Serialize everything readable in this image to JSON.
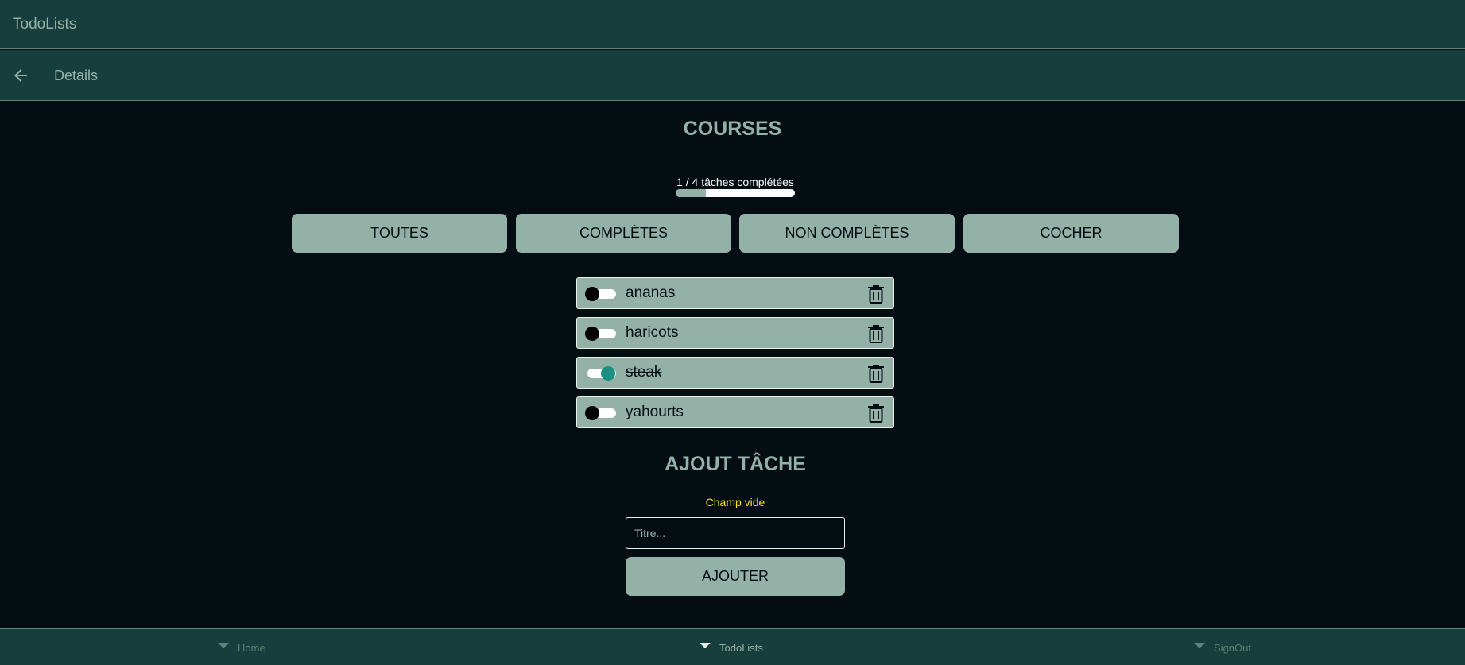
{
  "app": {
    "title": "TodoLists"
  },
  "subheader": {
    "title": "Details",
    "back_icon": "arrow-left-icon"
  },
  "list": {
    "title": "COURSES",
    "progress_text": "1 / 4 tâches complétées",
    "progress_fraction": 0.25
  },
  "filters": [
    {
      "label": "TOUTES"
    },
    {
      "label": "COMPLÈTES"
    },
    {
      "label": "NON COMPLÈTES"
    },
    {
      "label": "COCHER"
    }
  ],
  "todos": [
    {
      "label": "ananas",
      "done": false
    },
    {
      "label": "haricots",
      "done": false
    },
    {
      "label": "steak",
      "done": true
    },
    {
      "label": "yahourts",
      "done": false
    }
  ],
  "add_task": {
    "title": "AJOUT TÂCHE",
    "warning": "Champ vide",
    "input_placeholder": "Titre...",
    "input_value": "",
    "button_label": "AJOUTER"
  },
  "bottom_nav": [
    {
      "label": "Home",
      "active": false
    },
    {
      "label": "TodoLists",
      "active": true
    },
    {
      "label": "SignOut",
      "active": false
    }
  ],
  "colors": {
    "background": "#040d12",
    "bar": "#183d3d",
    "accent": "#93b1a6",
    "toggle_on": "#1a8f84",
    "warning": "#ffe500"
  }
}
